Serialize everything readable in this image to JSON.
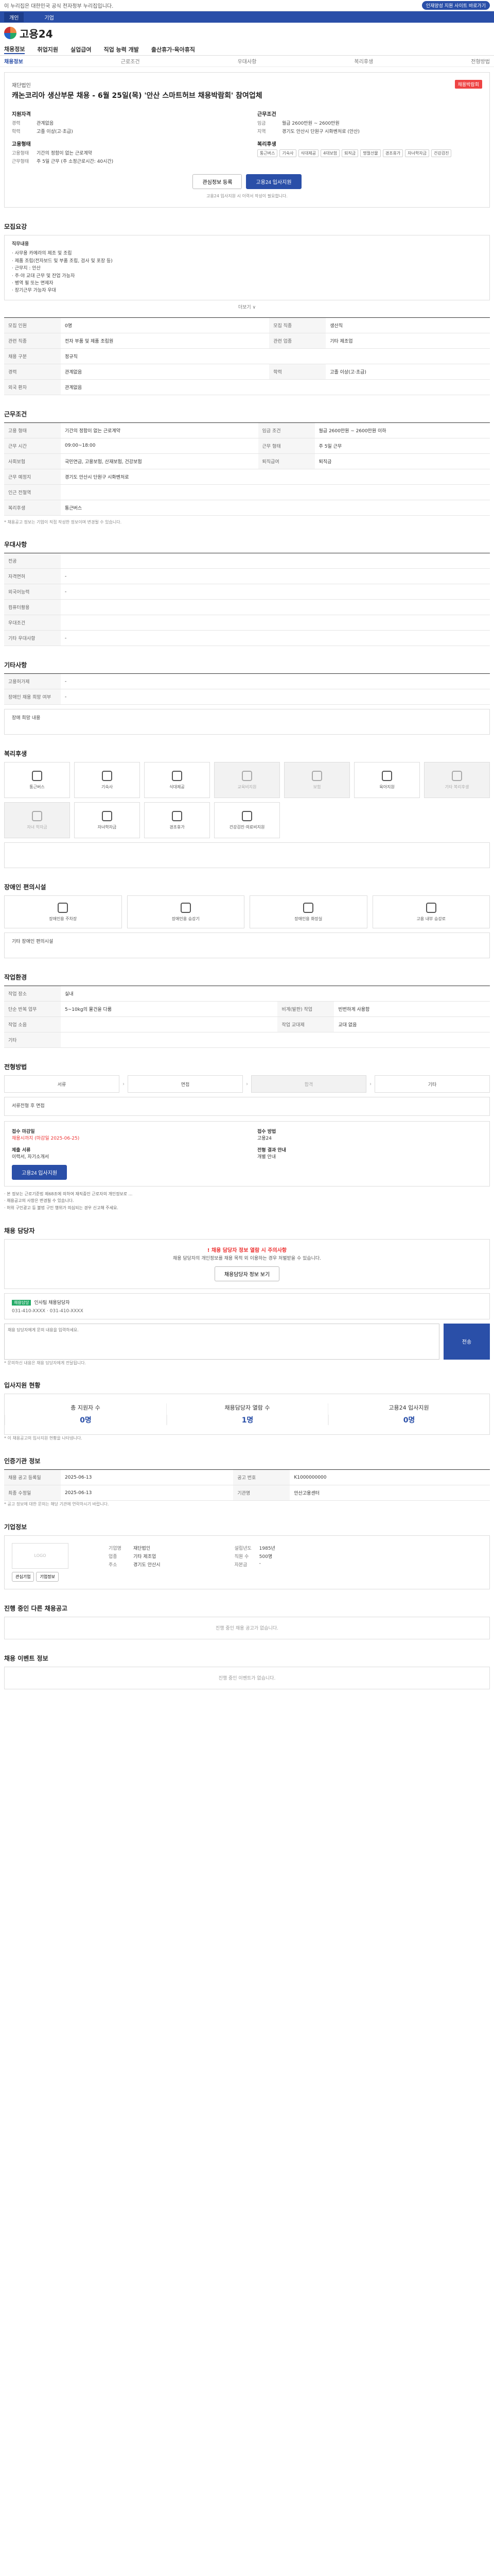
{
  "topbar": {
    "notice": "이 누리집은 대한민국 공식 전자정부 누리집입니다.",
    "link": "인재양성 지원 사이트 바로가기"
  },
  "nav": {
    "tab1": "개인",
    "tab2": "기업"
  },
  "brand": {
    "name": "고용24"
  },
  "menu": [
    "채용정보",
    "취업지원",
    "실업급여",
    "직업 능력 개발",
    "출산휴가·육아휴직"
  ],
  "submenu": [
    "채용정보",
    "근로조건",
    "우대사항",
    "복리후생",
    "전형방법"
  ],
  "job": {
    "company": "재단법인",
    "title": "캐논코리아 생산부문 채용 - 6월 25일(목) '안산 스마트허브 채용박람회' 참여업체",
    "badge": "채용박람회",
    "left": {
      "head1": "지원자격",
      "k1": "경력",
      "v1": "관계없음",
      "k2": "학력",
      "v2": "고졸 이상(고·초급)",
      "head2": "고용형태",
      "k3": "고용형태",
      "v3": "기간의 정함이 없는 근로계약",
      "k4": "근무형태",
      "v4": "주 5일 근무 (주 소정근로시간: 40시간)"
    },
    "right": {
      "head1": "근무조건",
      "k1": "임금",
      "v1": "월급 2600만원 ~ 2600만원",
      "k2": "지역",
      "v2": "경기도 안산시 단원구 시화벤처로 (안산)",
      "head2": "복리후생",
      "chips": [
        "통근버스",
        "기숙사",
        "식대제공",
        "4대보험",
        "퇴직금",
        "명절선물",
        "경조휴가",
        "자녀학자금",
        "건강검진"
      ]
    },
    "btn_interest": "관심정보 등록",
    "btn_apply": "고용24 입사지원",
    "note": "고용24 입사지원 시 이력서 작성이 필요합니다."
  },
  "sections": {
    "content": "모집요강",
    "job_type": "직무내용",
    "lines": [
      "· 사무용 카메라의 제조 및 조립",
      "· 제품 조립(전자보드 및 부품 조립, 검사 및 포장 등)",
      "· 근무지 : 안산",
      "· 주·야 교대 근무 및 잔업 가능자",
      "· 병역 필 또는 면제자",
      "· 장기근무 가능자 우대"
    ],
    "more": "더보기 ∨"
  },
  "detail": {
    "rows": [
      [
        "모집 인원",
        "0명",
        "모집 직종",
        "생산직"
      ],
      [
        "관련 직종",
        "전자 부품 및 제품 조립원",
        "관련 업종",
        "기타 제조업"
      ],
      [
        "채용 구분",
        "정규직",
        "",
        ""
      ],
      [
        "경력",
        "관계없음",
        "학력",
        "고졸 이상(고·초급)"
      ],
      [
        "외국 환자",
        "관계없음",
        "",
        ""
      ]
    ]
  },
  "cond": {
    "title": "근무조건",
    "rows": [
      [
        "고용 형태",
        "기간의 정함이 없는 근로계약",
        "임금 조건",
        "월급 2600만원 ~ 2600만원 이하"
      ],
      [
        "근무 시간",
        "09:00~18:00",
        "근무 형태",
        "주 5일 근무"
      ],
      [
        "사회보험",
        "국민연금, 고용보험, 산재보험, 건강보험",
        "퇴직급여",
        "퇴직금"
      ],
      [
        "근무 예정지",
        "경기도 안산시 단원구 시화벤처로",
        "",
        ""
      ],
      [
        "인근 전철역",
        "",
        "",
        ""
      ],
      [
        "복리후생",
        "통근버스",
        "",
        ""
      ]
    ],
    "note": "* 채용공고 정보는 기업이 직접 작성한 정보이며 변경될 수 있습니다."
  },
  "pref": {
    "title": "우대사항",
    "rows": [
      [
        "전공",
        ""
      ],
      [
        "자격면허",
        "-"
      ],
      [
        "외국어능력",
        "-"
      ],
      [
        "컴퓨터활용",
        ""
      ],
      [
        "우대조건",
        ""
      ],
      [
        "기타 우대사항",
        "-"
      ]
    ]
  },
  "other": {
    "title": "기타사항",
    "rows": [
      [
        "고용허가제",
        "-"
      ],
      [
        "장애인 채용 희망 여부",
        "-"
      ]
    ],
    "note": "장애 희망 내용"
  },
  "welfare": {
    "title": "복리후생",
    "items": [
      "통근버스",
      "기숙사",
      "식대제공",
      "교육비지원",
      "보험",
      "육아지원",
      "기타 복리후생"
    ],
    "items2": [
      "자녀 학자금",
      "자녀학자금",
      "경조휴가",
      "건강검진·의료비지원"
    ],
    "off": [
      3,
      4,
      6
    ]
  },
  "dis": {
    "title": "장애인 편의시설",
    "items": [
      "장애인용 주차장",
      "장애인용 승강기",
      "장애인용 화장실",
      "고용 내부 승강로"
    ],
    "note": "기타 장애인 편의시설"
  },
  "env": {
    "title": "작업환경",
    "rows": [
      [
        "작업 장소",
        "실내",
        "",
        ""
      ],
      [
        "단순 반복 업무",
        "5~10kg의 물건을 다룸",
        "비계(발판) 작업",
        "빈번하게 사용함"
      ],
      [
        "작업 소음",
        "",
        "작업 교대제",
        "교대 없음"
      ],
      [
        "기타",
        "",
        "",
        "기타사항"
      ]
    ]
  },
  "process": {
    "title": "전형방법",
    "steps": [
      "서류",
      "면접",
      "합격",
      "기타"
    ],
    "method": "서류전형 후 면접",
    "docs_title": "제출 서류",
    "docs": "이력서, 자기소개서",
    "receipt_title": "접수 마감일",
    "receipt_date": "채용시까지 (마감일 2025-06-25)",
    "receipt_method": "접수 방법",
    "receipt_method_v": "고용24",
    "apply": "고용24 입사지원",
    "contact_title": "전형 결과 안내",
    "contact_v": "개별 안내"
  },
  "notes": [
    "· 본 정보는 근로기준법 제68조에 의하여 재직중인 근로자의 개인정보로 ...",
    "· 채용공고의 사항은 변경될 수 있습니다.",
    "· 허위 구인광고 등 불법 구인 행위가 의심되는 경우 신고해 주세요."
  ],
  "person": {
    "title": "채용 담당자",
    "warn_head": "! 채용 담당자 정보 열람 시 주의사항",
    "warn": "채용 담당자의 개인정보를 채용 목적 외 이용하는 경우 처벌받을 수 있습니다.",
    "btn": "채용담당자 정보 보기",
    "tag": "채용담당",
    "name": "인사팀 채용담당자",
    "phone": "031-410-XXXX",
    "fax": "031-410-XXXX",
    "qa_placeholder": "채용 담당자에게 문의 내용을 입력하세요.",
    "qa_send": "전송",
    "qa_note": "* 문의하신 내용은 채용 담당자에게 전달됩니다."
  },
  "status": {
    "title": "입사지원 현황",
    "cols": [
      "총 지원자 수",
      "채용담당자 열람 수",
      "고용24 입사지원"
    ],
    "vals": [
      "0명",
      "1명",
      "0명"
    ],
    "note": "* 이 채용공고의 입사지원 현황을 나타냅니다."
  },
  "reg": {
    "title": "인증기관 정보",
    "rows": [
      [
        "채용 공고 등록일",
        "2025-06-13",
        "공고 번호",
        "K1000000000"
      ],
      [
        "최종 수정일",
        "2025-06-13",
        "기관명",
        "안산고용센터"
      ]
    ],
    "note": "* 공고 정보에 대한 문의는 해당 기관에 연락하시기 바랍니다."
  },
  "company": {
    "title": "기업정보",
    "rows": [
      [
        "기업명",
        "재단법인",
        "설립년도",
        "1985년"
      ],
      [
        "업종",
        "기타 제조업",
        "직원 수",
        "500명"
      ],
      [
        "주소",
        "경기도 안산시",
        "자본금",
        "-"
      ]
    ],
    "btn1": "관심기업",
    "btn2": "기업정보"
  },
  "others": {
    "title": "진행 중인 다른 채용공고",
    "empty": "진행 중인 채용 공고가 없습니다."
  },
  "related": {
    "title": "채용 이벤트 정보",
    "empty": "진행 중인 이벤트가 없습니다."
  }
}
